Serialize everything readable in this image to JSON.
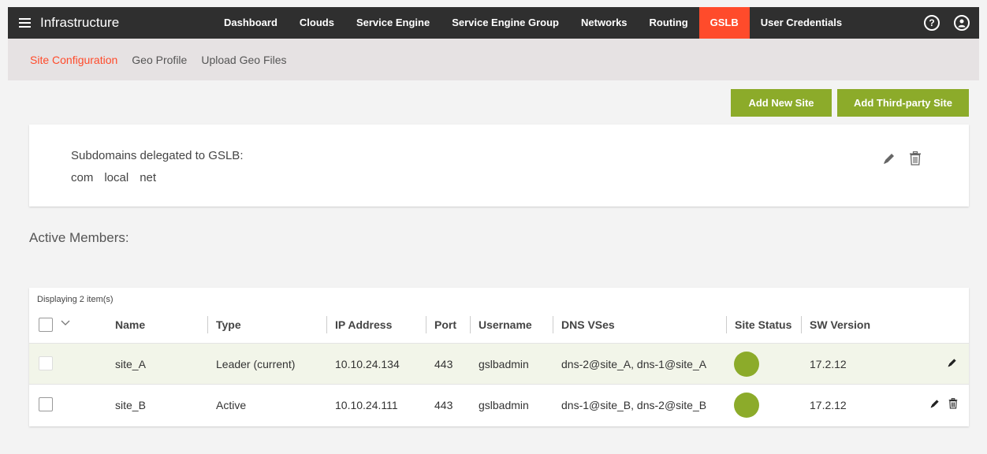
{
  "header": {
    "title": "Infrastructure",
    "nav": [
      {
        "label": "Dashboard",
        "active": false
      },
      {
        "label": "Clouds",
        "active": false
      },
      {
        "label": "Service Engine",
        "active": false
      },
      {
        "label": "Service Engine Group",
        "active": false
      },
      {
        "label": "Networks",
        "active": false
      },
      {
        "label": "Routing",
        "active": false
      },
      {
        "label": "GSLB",
        "active": true
      },
      {
        "label": "User Credentials",
        "active": false
      }
    ],
    "help_icon": "?",
    "accent_color": "#ff4b2b"
  },
  "subnav": {
    "items": [
      {
        "label": "Site Configuration",
        "active": true
      },
      {
        "label": "Geo Profile",
        "active": false
      },
      {
        "label": "Upload Geo Files",
        "active": false
      }
    ]
  },
  "actions": {
    "add_new_site": "Add New Site",
    "add_third_party_site": "Add Third-party Site",
    "button_color": "#8cab2a"
  },
  "subdomains": {
    "title": "Subdomains delegated to GSLB:",
    "domains": [
      "com",
      "local",
      "net"
    ]
  },
  "active_members": {
    "title": "Active Members:",
    "count_text": "Displaying 2 item(s)",
    "columns": [
      "Name",
      "Type",
      "IP Address",
      "Port",
      "Username",
      "DNS VSes",
      "Site Status",
      "SW Version"
    ],
    "rows": [
      {
        "name": "site_A",
        "type": "Leader (current)",
        "ip": "10.10.24.134",
        "port": "443",
        "username": "gslbadmin",
        "dns_vses": "dns-2@site_A, dns-1@site_A",
        "status_color": "#8cab2a",
        "sw_version": "17.2.12",
        "deletable": false
      },
      {
        "name": "site_B",
        "type": "Active",
        "ip": "10.10.24.111",
        "port": "443",
        "username": "gslbadmin",
        "dns_vses": "dns-1@site_B, dns-2@site_B",
        "status_color": "#8cab2a",
        "sw_version": "17.2.12",
        "deletable": true
      }
    ]
  }
}
